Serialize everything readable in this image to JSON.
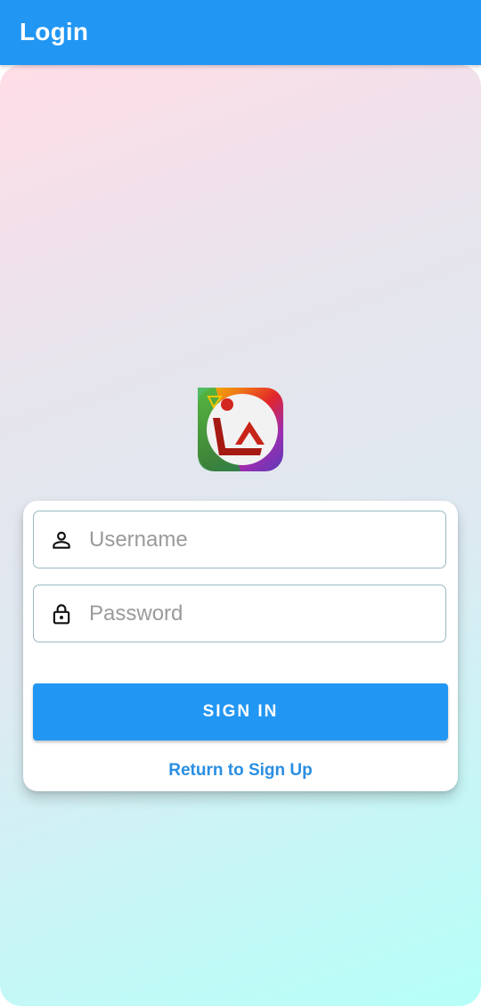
{
  "appbar": {
    "title": "Login"
  },
  "logo": {
    "name": "app-logo",
    "text": "LA"
  },
  "form": {
    "username": {
      "placeholder": "Username",
      "value": "",
      "icon": "person-icon"
    },
    "password": {
      "placeholder": "Password",
      "value": "",
      "icon": "lock-icon"
    },
    "signin_label": "SIGN IN",
    "signup_link": "Return to Sign Up"
  },
  "colors": {
    "primary": "#2196F3",
    "link": "#2A8EE2",
    "field_border": "#9BB8C4",
    "bg_top": "#FFDDE7",
    "bg_bottom": "#B6FFF8"
  }
}
